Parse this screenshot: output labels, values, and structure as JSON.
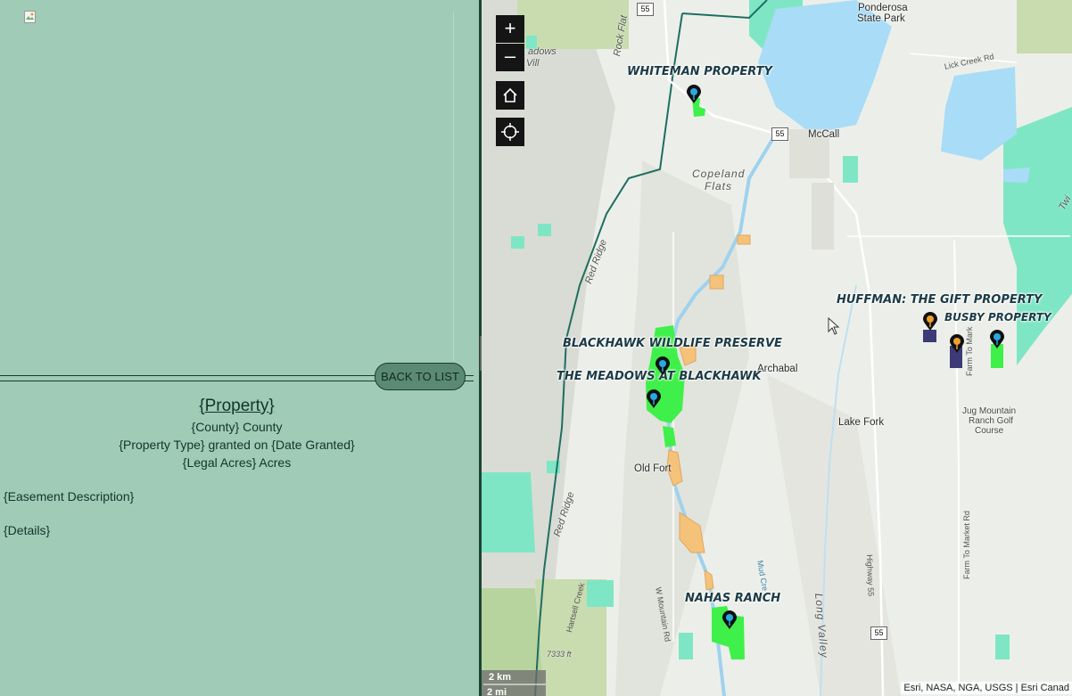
{
  "left": {
    "back_label": "BACK TO LIST",
    "property": "{Property}",
    "county_line": "{County} County",
    "type_line": "{Property Type} granted on {Date Granted}",
    "acres_line": "{Legal Acres} Acres",
    "easement": "{Easement Description}",
    "details": "{Details}"
  },
  "map": {
    "places": {
      "ponderosa": "Ponderosa",
      "state_park": "State Park",
      "mccall": "McCall",
      "copeland1": "Copeland",
      "copeland2": "Flats",
      "archabal": "Archabal",
      "lake_fork": "Lake Fork",
      "old_fort": "Old Fort",
      "jug1": "Jug Mountain",
      "jug2": "Ranch Golf",
      "jug3": "Course",
      "meadows1": "adows",
      "meadows2": "Vill",
      "rock_flat": "Rock Flat",
      "red_ridge": "Red Ridge",
      "red_ridge2": "Red Ridge",
      "long_valley": "Long Valley",
      "elev": "7333 ft",
      "twin": "Twi"
    },
    "roads": {
      "lick_creek": "Lick Creek Rd",
      "farm_market": "Farm To Market Rd",
      "farm_market2": "Farm To Mark",
      "highway55": "Highway 55",
      "w_mountain": "W Mountain Rd",
      "hartsell": "Hartsell Creek",
      "mud_creek": "Mud Cre"
    },
    "shields": [
      "55",
      "55",
      "55"
    ],
    "properties": {
      "whiteman": "WHITEMAN PROPERTY",
      "blackhawk": "BLACKHAWK WILDLIFE PRESERVE",
      "meadows": "THE MEADOWS AT BLACKHAWK",
      "huffman": "HUFFMAN: THE GIFT PROPERTY",
      "busby": "BUSBY PROPERTY",
      "nahas": "NAHAS RANCH"
    },
    "scale": {
      "km": "2 km",
      "mi": "2 mi"
    },
    "attribution": "Esri, NASA, NGA, USGS | Esri Canad",
    "colors": {
      "blue_pin": "#2aa8e0",
      "orange_pin": "#f0a030",
      "easement_green": "#3ff04a",
      "pending_orange": "#f5c27a",
      "public_land": "#7fe6c5"
    }
  }
}
